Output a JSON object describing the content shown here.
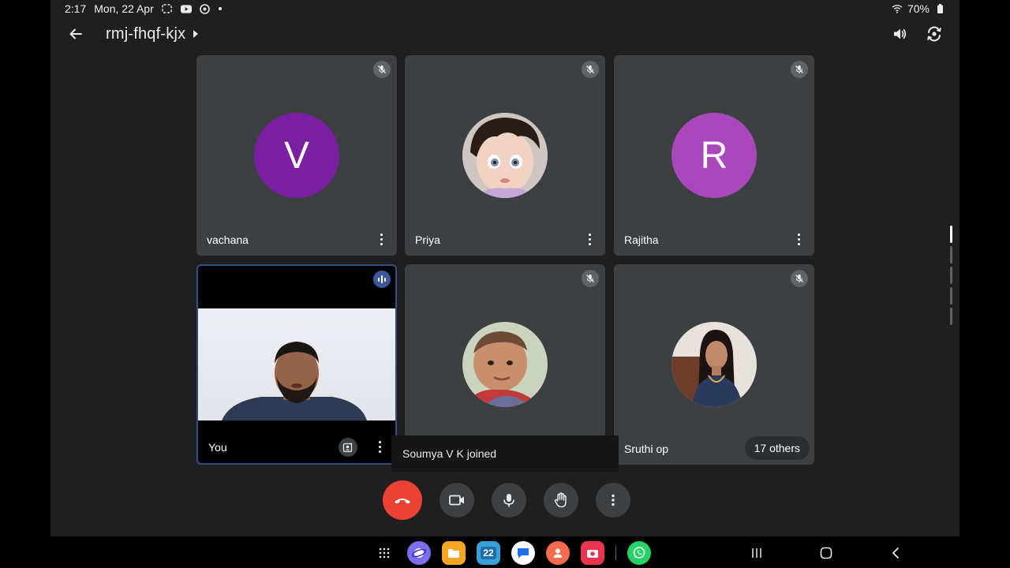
{
  "status_bar": {
    "time": "2:17",
    "date": "Mon, 22 Apr",
    "battery": "70%"
  },
  "header": {
    "meeting_code": "rmj-fhqf-kjx"
  },
  "participants": [
    {
      "name": "vachana",
      "initial": "V",
      "avatar_color": "#7b1fa2",
      "muted": true
    },
    {
      "name": "Priya",
      "initial": "",
      "avatar_color": "#c9a487",
      "muted": true
    },
    {
      "name": "Rajitha",
      "initial": "R",
      "avatar_color": "#ab47bc",
      "muted": true
    },
    {
      "name": "You",
      "initial": "",
      "avatar_color": "#000000",
      "muted": false
    },
    {
      "name": "",
      "initial": "",
      "avatar_color": "#b7906c",
      "muted": true
    },
    {
      "name": "Sruthi op",
      "initial": "",
      "avatar_color": "#6b4a3a",
      "muted": true
    }
  ],
  "others_chip": "17 others",
  "toast": "Soumya V K joined",
  "calendar_app_day": "22",
  "colors": {
    "accent_end_call": "#ea4335",
    "tile_bg": "#3c4043",
    "screen_bg": "#1f1f1f",
    "active_speaker_border": "#2f4f7f"
  }
}
